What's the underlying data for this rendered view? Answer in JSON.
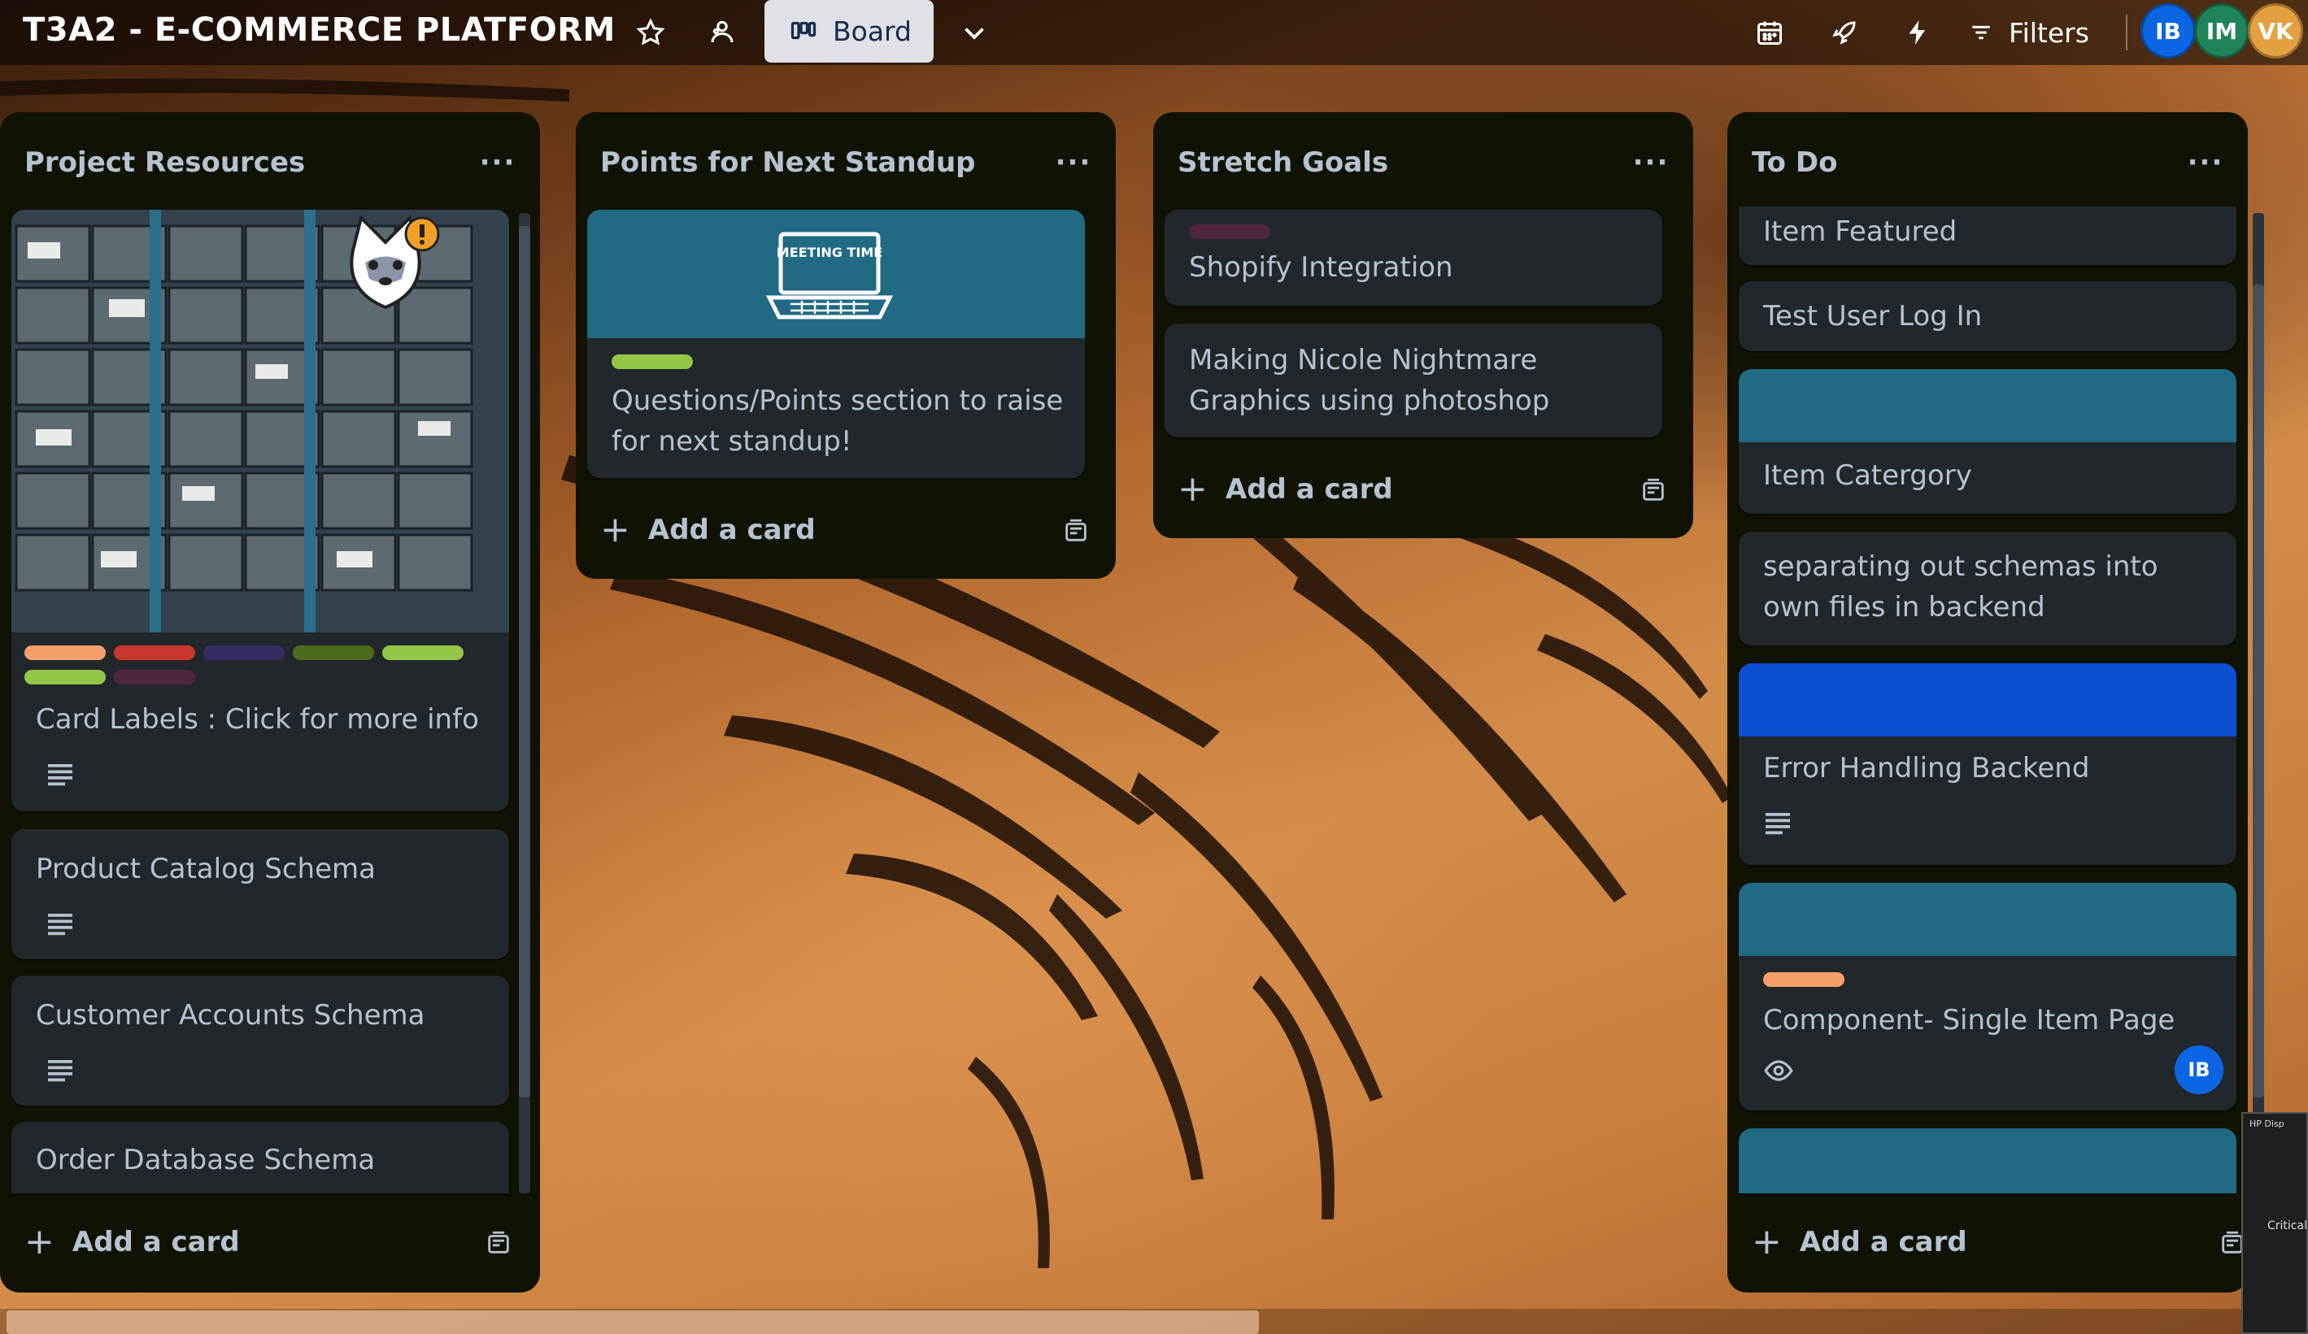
{
  "header": {
    "board_title": "T3A2 - E-COMMERCE PLATFORM",
    "view_button_label": "Board",
    "filters_label": "Filters",
    "members": [
      {
        "initials": "IB",
        "color": "#0c66e4"
      },
      {
        "initials": "IM",
        "color": "#1f845a"
      },
      {
        "initials": "VK",
        "color": "#e2a03f"
      }
    ]
  },
  "lists": [
    {
      "title": "Project Resources",
      "cards": [
        {
          "title": "Card Labels : Click for more info",
          "labels": [
            "#f5a06b",
            "#c9372c",
            "#352c63",
            "#4c6b1f",
            "#94c748",
            "#94c748",
            "#50253f"
          ],
          "has_description": true,
          "cover": "image"
        },
        {
          "title": "Product Catalog Schema",
          "has_description": true
        },
        {
          "title": "Customer Accounts Schema",
          "has_description": true
        },
        {
          "title": "Order Database Schema"
        }
      ],
      "add_card_label": "Add a card"
    },
    {
      "title": "Points for Next Standup",
      "cards": [
        {
          "title": "Questions/Points section to raise for next standup!",
          "labels": [
            "#94c748"
          ],
          "cover": "#206a83",
          "cover_sticker_text": "MEETING TIME"
        }
      ],
      "add_card_label": "Add a card"
    },
    {
      "title": "Stretch Goals",
      "cards": [
        {
          "title": "Shopify Integration",
          "labels": [
            "#50253f"
          ]
        },
        {
          "title": "Making Nicole Nightmare Graphics using photoshop"
        }
      ],
      "add_card_label": "Add a card"
    },
    {
      "title": "To Do",
      "cards": [
        {
          "title": "Item Featured"
        },
        {
          "title": "Test User Log In"
        },
        {
          "title": "Item Catergory",
          "cover": "#206a83"
        },
        {
          "title": "separating out schemas into own files in backend"
        },
        {
          "title": "Error Handling Backend",
          "cover": "#0c4fd1",
          "has_description": true
        },
        {
          "title": "Component- Single Item Page",
          "cover": "#206a83",
          "labels": [
            "#f5a06b"
          ],
          "watching": true,
          "member": "IB"
        },
        {
          "title": "",
          "cover": "#206a83"
        }
      ],
      "add_card_label": "Add a card"
    }
  ],
  "popup": {
    "title": "HP Disp",
    "text": "Critical"
  }
}
